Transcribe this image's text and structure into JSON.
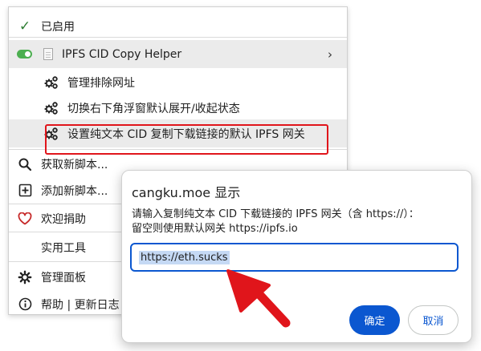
{
  "colors": {
    "accent": "#0b57d0",
    "highlight_box": "#e0151b",
    "arrow": "#e0151b",
    "toggle_on": "#4caf50"
  },
  "menu": {
    "enabled_label": "已启用",
    "enabled_icon": "checkmark-icon",
    "script": {
      "name": "IPFS CID Copy Helper",
      "toggle": "on",
      "submenu_icon": "chevron-right-icon"
    },
    "commands": [
      {
        "label": "管理排除网址",
        "icon": "gears-icon"
      },
      {
        "label": "切换右下角浮窗默认展开/收起状态",
        "icon": "gears-icon"
      },
      {
        "label": "设置纯文本 CID 复制下载链接的默认 IPFS 网关",
        "icon": "gears-icon"
      }
    ],
    "items": [
      {
        "label": "获取新脚本...",
        "icon": "search-icon"
      },
      {
        "label": "添加新脚本...",
        "icon": "plus-square-icon"
      },
      {
        "label": "欢迎捐助",
        "icon": "heart-icon"
      },
      {
        "label": "实用工具",
        "icon": ""
      },
      {
        "label": "管理面板",
        "icon": "gear-icon"
      },
      {
        "label": "帮助 | 更新日志",
        "icon": "info-icon"
      }
    ]
  },
  "dialog": {
    "title": "cangku.moe 显示",
    "message_line1": "请输入复制纯文本 CID 下载链接的 IPFS 网关（含 https://）：",
    "message_line2": "留空则使用默认网关 https://ipfs.io",
    "input_value": "https://eth.sucks",
    "ok_label": "确定",
    "cancel_label": "取消"
  }
}
